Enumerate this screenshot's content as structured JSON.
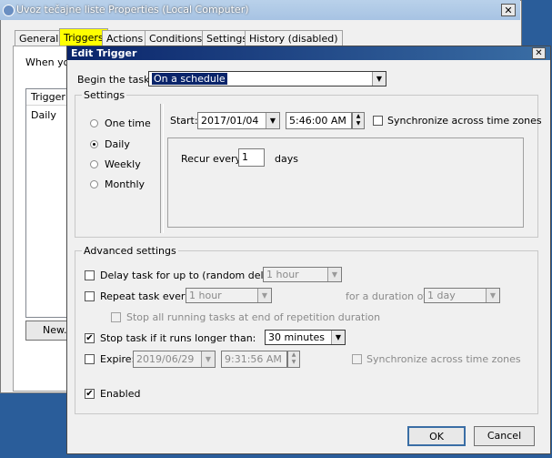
{
  "bg_window": {
    "title": "Uvoz tečajne liste Properties (Local Computer)",
    "tabs": [
      {
        "label": "General"
      },
      {
        "label": "Triggers"
      },
      {
        "label": "Actions"
      },
      {
        "label": "Conditions"
      },
      {
        "label": "Settings"
      },
      {
        "label": "History (disabled)"
      }
    ],
    "when_text": "When yo",
    "list_header": "Trigger",
    "list_row": "Daily",
    "new_button": "New..."
  },
  "dialog": {
    "title": "Edit Trigger",
    "begin_label": "Begin the task:",
    "begin_value": "On a schedule",
    "settings_group": "Settings",
    "schedule_options": [
      "One time",
      "Daily",
      "Weekly",
      "Monthly"
    ],
    "selected_schedule": "Daily",
    "start_label": "Start:",
    "start_date": "2017/01/04",
    "start_time": "5:46:00 AM",
    "sync_label": "Synchronize across time zones",
    "recur_label": "Recur every:",
    "recur_value": "1",
    "recur_unit": "days",
    "advanced_group": "Advanced settings",
    "delay_label": "Delay task for up to (random delay):",
    "delay_value": "1 hour",
    "repeat_label": "Repeat task every:",
    "repeat_value": "1 hour",
    "duration_label": "for a duration of:",
    "duration_value": "1 day",
    "stop_running_label": "Stop all running tasks at end of repetition duration",
    "stop_if_label": "Stop task if it runs longer than:",
    "stop_if_value": "30 minutes",
    "expire_label": "Expire:",
    "expire_date": "2019/06/29",
    "expire_time": "9:31:56 AM",
    "expire_sync_label": "Synchronize across time zones",
    "enabled_label": "Enabled",
    "ok_label": "OK",
    "cancel_label": "Cancel"
  }
}
